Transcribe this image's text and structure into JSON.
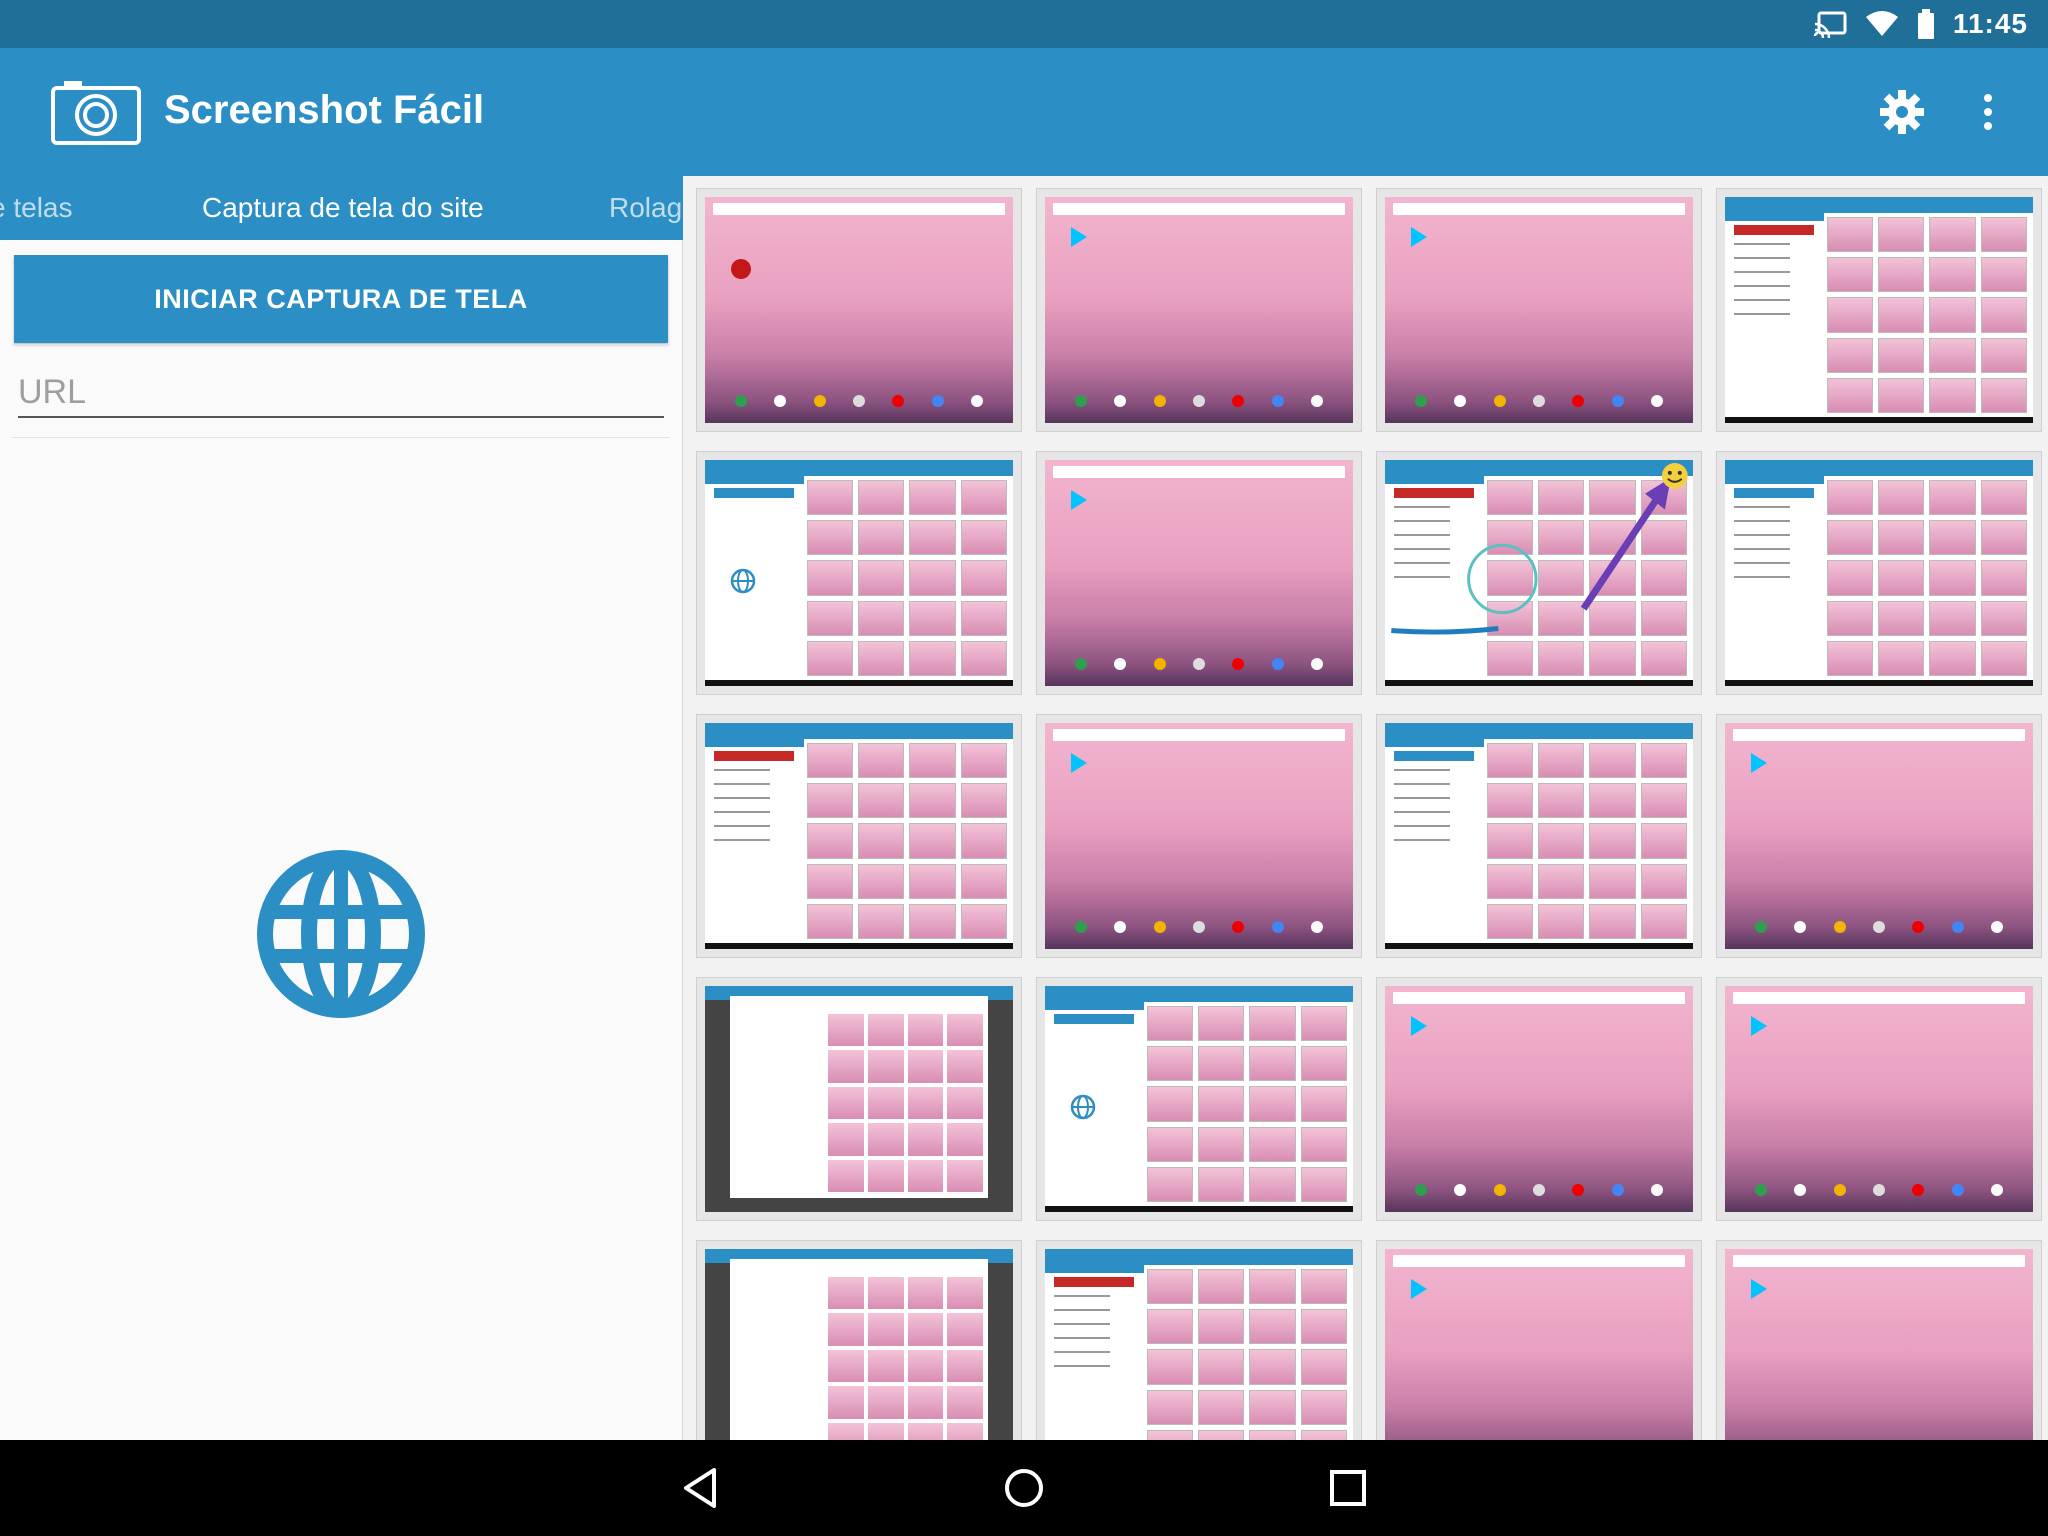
{
  "status_bar": {
    "time": "11:45",
    "icons": [
      "cast-icon",
      "wifi-icon",
      "battery-icon"
    ]
  },
  "app_bar": {
    "title": "Screenshot Fácil",
    "logo_icon": "camera-icon",
    "actions": [
      "settings-gear-icon",
      "more-vert-icon"
    ]
  },
  "tabs": {
    "left": "e telas",
    "active": "Captura de tela do site",
    "right": "Rolage"
  },
  "capture_button": "INICIAR CAPTURA DE TELA",
  "url_field": {
    "placeholder": "URL",
    "value": ""
  },
  "thumbnails": [
    {
      "kind": "home",
      "variant": "red"
    },
    {
      "kind": "home",
      "variant": "play"
    },
    {
      "kind": "home",
      "variant": "play"
    },
    {
      "kind": "app",
      "variant": "red"
    },
    {
      "kind": "app",
      "variant": "globe"
    },
    {
      "kind": "home",
      "variant": "play"
    },
    {
      "kind": "app",
      "variant": "annotated"
    },
    {
      "kind": "app",
      "variant": "blue"
    },
    {
      "kind": "app",
      "variant": "red"
    },
    {
      "kind": "home",
      "variant": "play"
    },
    {
      "kind": "app",
      "variant": "blue"
    },
    {
      "kind": "home",
      "variant": "play"
    },
    {
      "kind": "dark",
      "variant": "crop"
    },
    {
      "kind": "app",
      "variant": "globe"
    },
    {
      "kind": "home",
      "variant": "play"
    },
    {
      "kind": "home",
      "variant": "play"
    },
    {
      "kind": "dark",
      "variant": "view"
    },
    {
      "kind": "app",
      "variant": "red"
    },
    {
      "kind": "home",
      "variant": "play"
    },
    {
      "kind": "home",
      "variant": "play"
    }
  ],
  "nav_bar": {
    "buttons": [
      "back-icon",
      "home-icon",
      "recents-icon"
    ]
  },
  "colors": {
    "primary": "#2b8ec4",
    "primary_dark": "#1f6f99",
    "accent_red": "#c62828"
  }
}
